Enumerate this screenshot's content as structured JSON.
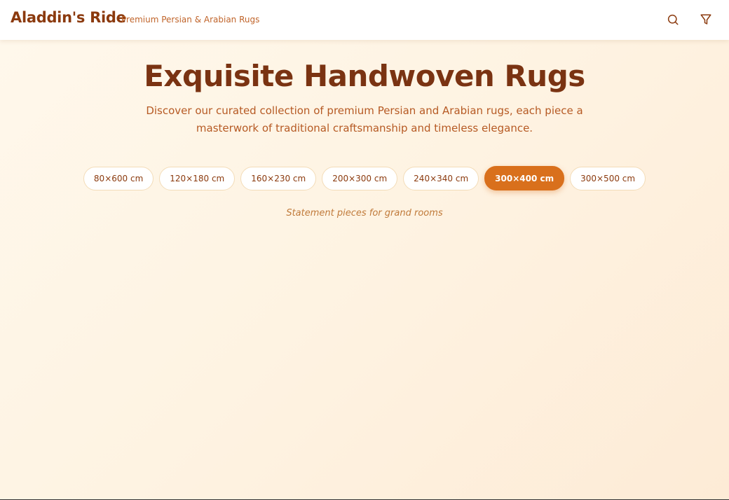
{
  "header": {
    "brand": "Aladdin's Ride",
    "tagline": "Premium Persian & Arabian Rugs",
    "search_icon": "search-icon",
    "filter_icon": "filter-icon"
  },
  "hero": {
    "title": "Exquisite Handwoven Rugs",
    "description": "Discover our curated collection of premium Persian and Arabian rugs, each piece a masterwork of traditional craftsmanship and timeless elegance."
  },
  "sizes": {
    "options": [
      "80×600 cm",
      "120×180 cm",
      "160×230 cm",
      "200×300 cm",
      "240×340 cm",
      "300×400 cm",
      "300×500 cm"
    ],
    "selected": "300×400 cm",
    "selected_note": "Statement pieces for grand rooms"
  },
  "colors": {
    "brand": "#8b3a0e",
    "accent": "#d9701c",
    "background": "#fef3e2"
  }
}
